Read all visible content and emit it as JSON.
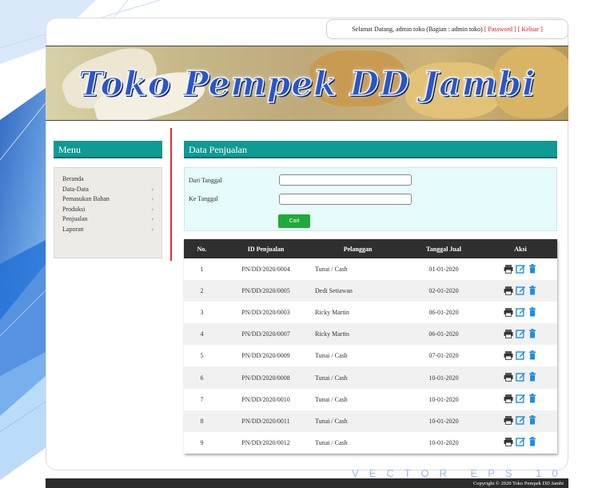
{
  "header": {
    "welcome_text": "Selamat Datang, admin toko (Bagian : admin toko)",
    "password_link": "[ Password ]",
    "logout_link": "[ Keluar ]"
  },
  "banner": {
    "title": "Toko Pempek DD Jambi"
  },
  "sidebar": {
    "title": "Menu",
    "items": [
      {
        "label": "Beranda",
        "has_submenu": false
      },
      {
        "label": "Data-Data",
        "has_submenu": true
      },
      {
        "label": "Pemasukan Bahan",
        "has_submenu": true
      },
      {
        "label": "Produksi",
        "has_submenu": true
      },
      {
        "label": "Penjualan",
        "has_submenu": true
      },
      {
        "label": "Laporan",
        "has_submenu": true
      }
    ]
  },
  "main": {
    "title": "Data Penjualan",
    "filter": {
      "from_label": "Dari Tanggal",
      "from_value": "",
      "to_label": "Ke Tanggal",
      "to_value": "",
      "search_button": "Cari"
    },
    "table": {
      "columns": [
        "No.",
        "ID Penjualan",
        "Pelanggan",
        "Tanggal Jual",
        "Aksi"
      ],
      "rows": [
        [
          "1",
          "PN/DD/2020/0004",
          "Tunai / Cash",
          "01-01-2020"
        ],
        [
          "2",
          "PN/DD/2020/0005",
          "Dedi Setiawan",
          "02-01-2020"
        ],
        [
          "3",
          "PN/DD/2020/0003",
          "Ricky Martin",
          "06-01-2020"
        ],
        [
          "4",
          "PN/DD/2020/0007",
          "Ricky Martin",
          "06-01-2020"
        ],
        [
          "5",
          "PN/DD/2020/0009",
          "Tunai / Cash",
          "07-01-2020"
        ],
        [
          "6",
          "PN/DD/2020/0008",
          "Tunai / Cash",
          "10-01-2020"
        ],
        [
          "7",
          "PN/DD/2020/0010",
          "Tunai / Cash",
          "10-01-2020"
        ],
        [
          "8",
          "PN/DD/2020/0011",
          "Tunai / Cash",
          "10-01-2020"
        ],
        [
          "9",
          "PN/DD/2020/0012",
          "Tunai / Cash",
          "10-01-2020"
        ]
      ],
      "action_icons": [
        "print-icon",
        "edit-icon",
        "delete-icon"
      ]
    }
  },
  "watermark": "VECTOR EPS 10",
  "footer": {
    "copyright": "Copyright © 2020 Toko Pempek DD Jambi"
  },
  "colors": {
    "teal": "#0f9a94",
    "red": "#e02020",
    "header_dark": "#2f2f2f",
    "filter_bg": "#e6fbfb"
  }
}
